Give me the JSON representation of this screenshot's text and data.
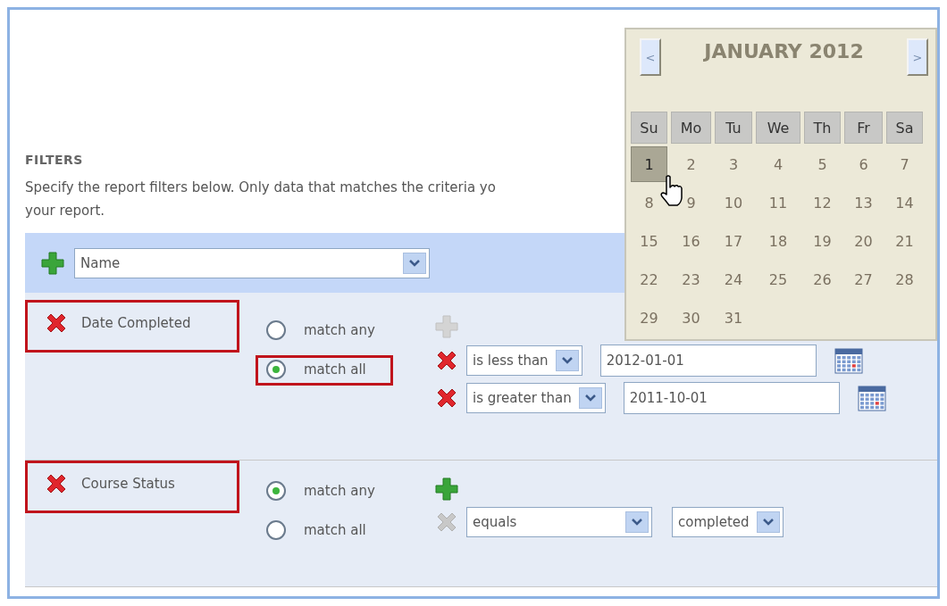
{
  "section_title": "FILTERS",
  "description_lines": [
    "Specify the report filters below. Only data that matches the criteria yo",
    "your report."
  ],
  "add_filter": {
    "value": "Name"
  },
  "filters": [
    {
      "name": "Date Completed",
      "highlighted": true,
      "add_enabled": false,
      "match_options": [
        {
          "label": "match any",
          "selected": false,
          "highlighted": false
        },
        {
          "label": "match all",
          "selected": true,
          "highlighted": true
        }
      ],
      "conditions": [
        {
          "kind": "date",
          "remove_enabled": true,
          "operator": "is less than",
          "value": "2012-01-01"
        },
        {
          "kind": "date",
          "remove_enabled": true,
          "operator": "is greater than",
          "value": "2011-10-01"
        }
      ]
    },
    {
      "name": "Course Status",
      "highlighted": true,
      "add_enabled": true,
      "match_options": [
        {
          "label": "match any",
          "selected": true,
          "highlighted": false
        },
        {
          "label": "match all",
          "selected": false,
          "highlighted": false
        }
      ],
      "conditions": [
        {
          "kind": "choice",
          "remove_enabled": false,
          "operator": "equals",
          "value": "completed"
        }
      ]
    }
  ],
  "calendar": {
    "title": "JANUARY 2012",
    "prev": "<",
    "next": ">",
    "weekdays": [
      "Su",
      "Mo",
      "Tu",
      "We",
      "Th",
      "Fr",
      "Sa"
    ],
    "days": [
      {
        "label": "1",
        "selected": true
      },
      {
        "label": "2",
        "selected": false
      },
      {
        "label": "3",
        "selected": false
      },
      {
        "label": "4",
        "selected": false
      },
      {
        "label": "5",
        "selected": false
      },
      {
        "label": "6",
        "selected": false
      },
      {
        "label": "7",
        "selected": false
      },
      {
        "label": "8",
        "selected": false
      },
      {
        "label": "9",
        "selected": false
      },
      {
        "label": "10",
        "selected": false
      },
      {
        "label": "11",
        "selected": false
      },
      {
        "label": "12",
        "selected": false
      },
      {
        "label": "13",
        "selected": false
      },
      {
        "label": "14",
        "selected": false
      },
      {
        "label": "15",
        "selected": false
      },
      {
        "label": "16",
        "selected": false
      },
      {
        "label": "17",
        "selected": false
      },
      {
        "label": "18",
        "selected": false
      },
      {
        "label": "19",
        "selected": false
      },
      {
        "label": "20",
        "selected": false
      },
      {
        "label": "21",
        "selected": false
      },
      {
        "label": "22",
        "selected": false
      },
      {
        "label": "23",
        "selected": false
      },
      {
        "label": "24",
        "selected": false
      },
      {
        "label": "25",
        "selected": false
      },
      {
        "label": "26",
        "selected": false
      },
      {
        "label": "27",
        "selected": false
      },
      {
        "label": "28",
        "selected": false
      },
      {
        "label": "29",
        "selected": false
      },
      {
        "label": "30",
        "selected": false
      },
      {
        "label": "31",
        "selected": false
      }
    ]
  }
}
